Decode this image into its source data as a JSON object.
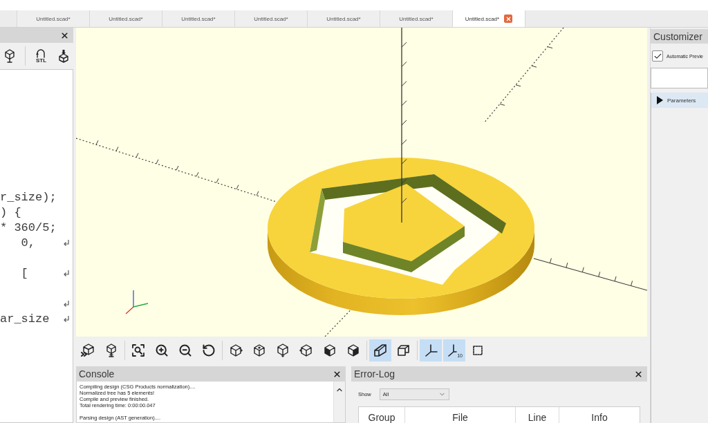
{
  "tabs": [
    {
      "label": "Untitled.scad*",
      "selected": false
    },
    {
      "label": "Untitled.scad*",
      "selected": false
    },
    {
      "label": "Untitled.scad*",
      "selected": false
    },
    {
      "label": "Untitled.scad*",
      "selected": false
    },
    {
      "label": "Untitled.scad*",
      "selected": false
    },
    {
      "label": "Untitled.scad*",
      "selected": false
    },
    {
      "label": "Untitled.scad*",
      "selected": true
    }
  ],
  "editor": {
    "toolbar": {
      "stl_label": "STL"
    },
    "lines": [
      {
        "text": "r_size);",
        "wrapped": false
      },
      {
        "text": ") {",
        "wrapped": false
      },
      {
        "text": "* 360/5;",
        "wrapped": false
      },
      {
        "text": "   0,",
        "wrapped": true
      },
      {
        "wrapped": false
      },
      {
        "text": "   [",
        "wrapped": true
      },
      {
        "wrapped": false
      },
      {
        "wrapped": true
      },
      {
        "text": "ar_size",
        "wrapped": true
      }
    ]
  },
  "viewport": {
    "toolbar": [
      [
        {
          "on": false
        },
        {
          "on": false
        }
      ],
      [
        {
          "on": false
        },
        {
          "on": false
        },
        {
          "on": false
        },
        {
          "on": false
        }
      ],
      [
        {
          "on": false
        },
        {
          "on": false
        },
        {
          "on": false
        },
        {
          "on": false
        },
        {
          "on": false
        },
        {
          "on": false
        }
      ],
      [
        {
          "on": true
        },
        {
          "on": false
        }
      ],
      [
        {
          "on": true
        },
        {
          "on": true,
          "label": "10"
        },
        {
          "on": false
        }
      ]
    ]
  },
  "console": {
    "title": "Console",
    "paragraphs": [
      [
        "Compiling design (CSG Products normalization)....",
        "Normalized tree has 5 elements!",
        "Compile and preview finished.",
        "Total rendering time: 0:00:00.047"
      ],
      [
        "Parsing design (AST generation)...."
      ]
    ]
  },
  "error_log": {
    "title": "Error-Log",
    "show_label": "Show",
    "filter": "All",
    "columns": [
      "Group",
      "File",
      "Line",
      "Info"
    ]
  },
  "customizer": {
    "title": "Customizer",
    "auto_preview": {
      "label": "Automatic Previe",
      "checked": true
    },
    "groups": [
      {
        "label": "Parameters",
        "expanded": false
      }
    ]
  }
}
